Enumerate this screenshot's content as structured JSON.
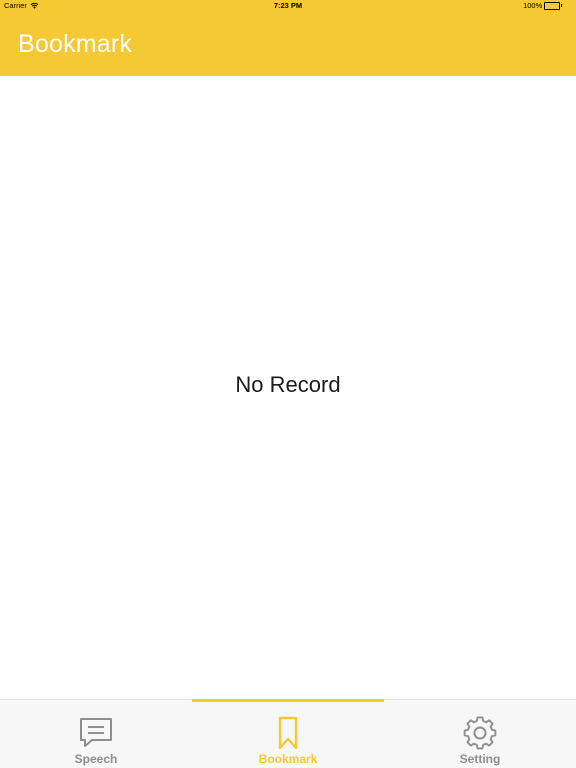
{
  "status_bar": {
    "carrier": "Carrier",
    "time": "7:23 PM",
    "battery": "100%",
    "wifi_icon": "wifi-icon",
    "battery_icon": "battery-icon",
    "charging_icon": "charging-bolt-icon"
  },
  "header": {
    "title": "Bookmark"
  },
  "main": {
    "empty_message": "No Record"
  },
  "tabs": [
    {
      "label": "Speech",
      "icon": "speech-bubble-icon",
      "active": false
    },
    {
      "label": "Bookmark",
      "icon": "bookmark-icon",
      "active": true
    },
    {
      "label": "Setting",
      "icon": "gear-icon",
      "active": false
    }
  ],
  "colors": {
    "accent": "#F4C934",
    "inactive_tab": "#8E8E8E",
    "tab_bar_bg": "#F7F7F7"
  }
}
